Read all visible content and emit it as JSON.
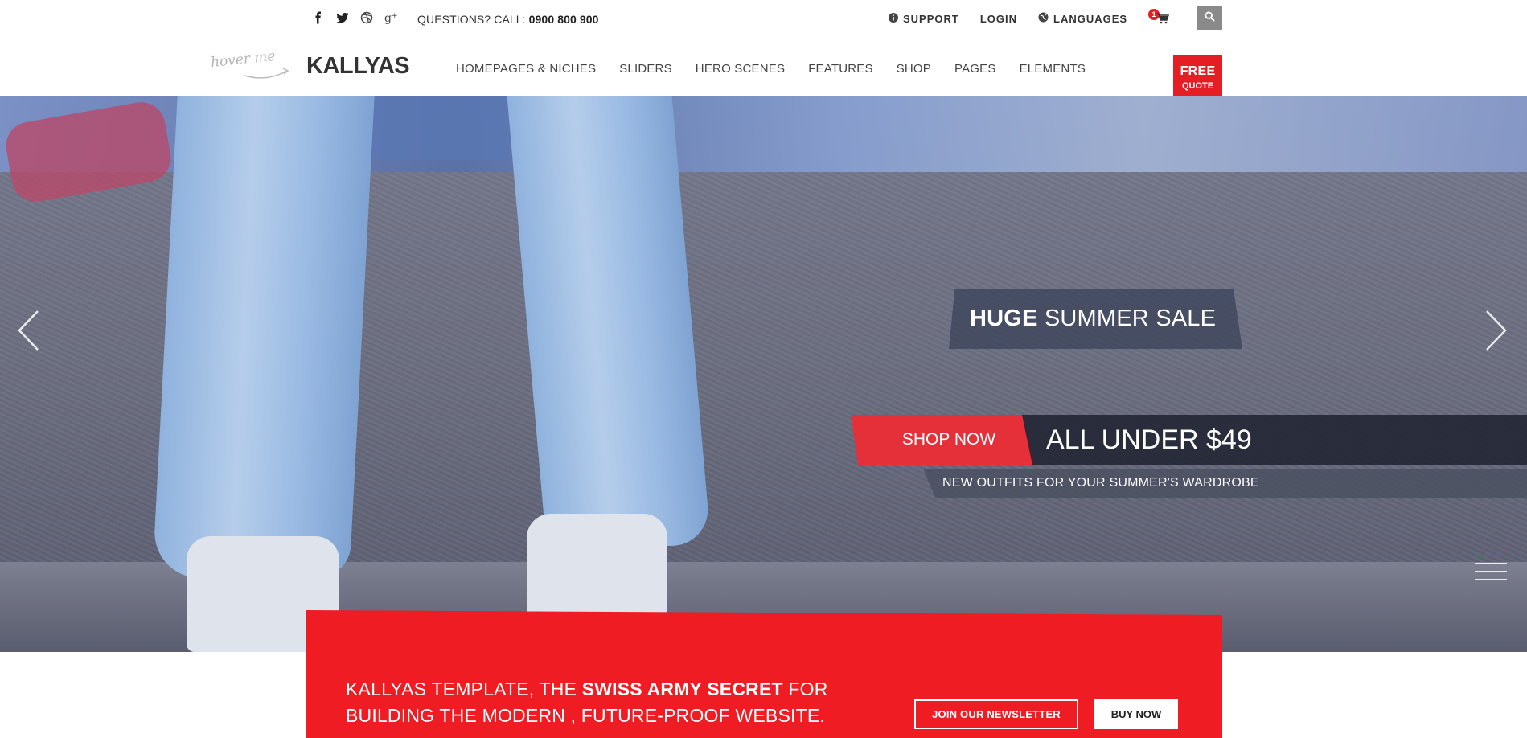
{
  "topbar": {
    "social": [
      "facebook-icon",
      "twitter-icon",
      "dribbble-icon",
      "google-plus-icon"
    ],
    "questions_label": "QUESTIONS? CALL:",
    "phone": "0900 800 900",
    "support": "SUPPORT",
    "login": "LOGIN",
    "languages": "LANGUAGES",
    "cart_count": "1"
  },
  "header": {
    "hover_me": "hover me",
    "logo": "KALLYAS",
    "nav": [
      "HOMEPAGES & NICHES",
      "SLIDERS",
      "HERO SCENES",
      "FEATURES",
      "SHOP",
      "PAGES",
      "ELEMENTS"
    ],
    "free_quote_top": "FREE",
    "free_quote_bottom": "QUOTE"
  },
  "hero": {
    "caption_bold": "HUGE",
    "caption_rest": "SUMMER SALE",
    "shop_now": "SHOP NOW",
    "price_line": "ALL UNDER $49",
    "subcaption": "NEW OUTFITS FOR YOUR SUMMER'S WARDROBE"
  },
  "promo": {
    "text_pre": "KALLYAS TEMPLATE, THE ",
    "text_bold": "SWISS ARMY SECRET",
    "text_post": " FOR BUILDING THE MODERN , FUTURE-PROOF WEBSITE.",
    "newsletter_btn": "JOIN OUR NEWSLETTER",
    "buy_btn": "BUY NOW"
  },
  "colors": {
    "accent_red": "#ef1c24",
    "search_gray": "#8a8a8a"
  }
}
